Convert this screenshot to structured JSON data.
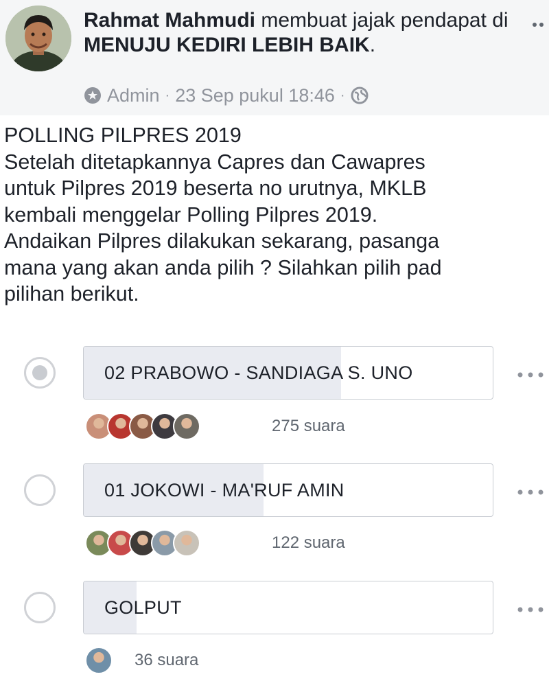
{
  "post": {
    "author": "Rahmat Mahmudi",
    "action": " membuat jajak pendapat di ",
    "group": "MENUJU KEDIRI LEBIH BAIK",
    "period": ".",
    "role": "Admin",
    "separator": "·",
    "timestamp": "23 Sep pukul 18:46",
    "more_icon": "more-horizontal-icon",
    "role_icon": "admin-badge-icon",
    "audience_icon": "globe-icon",
    "body_lines": [
      "POLLING PILPRES 2019",
      "Setelah ditetapkannya Capres dan Cawapres",
      "untuk Pilpres 2019 beserta no urutnya, MKLB",
      "kembali menggelar Polling Pilpres 2019.",
      "Andaikan Pilpres dilakukan sekarang, pasanga",
      "mana yang akan anda pilih ? Silahkan pilih pad",
      "pilihan berikut."
    ]
  },
  "poll": {
    "options": [
      {
        "label": "02 PRABOWO - SANDIAGA S. UNO",
        "votes_text": "275 suara",
        "votes": 275,
        "fill_fraction": 0.63,
        "selected": true,
        "voter_colors": [
          "#c98f78",
          "#b8362f",
          "#8a5a45",
          "#3d3a3f",
          "#6e6a62"
        ]
      },
      {
        "label": "01 JOKOWI - MA'RUF AMIN",
        "votes_text": "122 suara",
        "votes": 122,
        "fill_fraction": 0.44,
        "selected": false,
        "voter_colors": [
          "#7a8a5a",
          "#c84a4a",
          "#3e3a37",
          "#8a9aa8",
          "#c8c2b8"
        ]
      },
      {
        "label": "GOLPUT",
        "votes_text": "36 suara",
        "votes": 36,
        "fill_fraction": 0.13,
        "selected": false,
        "voter_colors": [
          "#6f8fa8"
        ]
      }
    ]
  }
}
